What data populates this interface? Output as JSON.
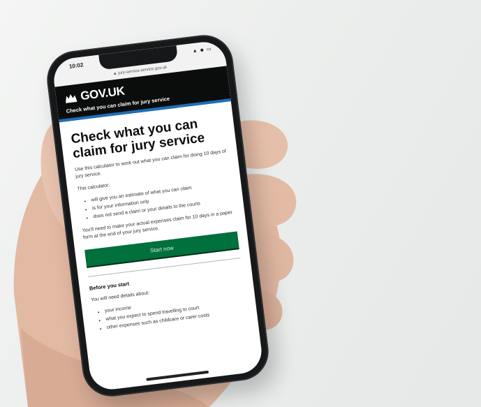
{
  "status_bar": {
    "time": "10:02",
    "icons": "▲ ◆ ▭"
  },
  "browser": {
    "url": "▲ jury-service.service.gov.uk"
  },
  "gov_header": {
    "logo_text": "GOV.UK",
    "service_name": "Check what you can claim for jury service"
  },
  "content": {
    "title": "Check what you can claim for jury service",
    "intro": "Use this calculator to work out what you can claim for doing 10 days of jury service.",
    "calc_lead": "This calculator:",
    "calc_points": [
      "will give you an estimate of what you can claim",
      "is for your information only",
      "does not send a claim or your details to the courts"
    ],
    "claim_note": "You'll need to make your actual expenses claim for 10 days in a paper form at the end of your jury service.",
    "start_button": "Start now",
    "before_heading": "Before you start",
    "need_lead": "You will need details about:",
    "need_points": [
      "your income",
      "what you expect to spend travelling to court",
      "other expenses such as childcare or carer costs"
    ]
  },
  "colors": {
    "header_bg": "#0b0c0c",
    "header_accent": "#1d70b8",
    "button_green": "#00703c",
    "phone_body": "#16181a",
    "skin": "#e4bca6"
  }
}
